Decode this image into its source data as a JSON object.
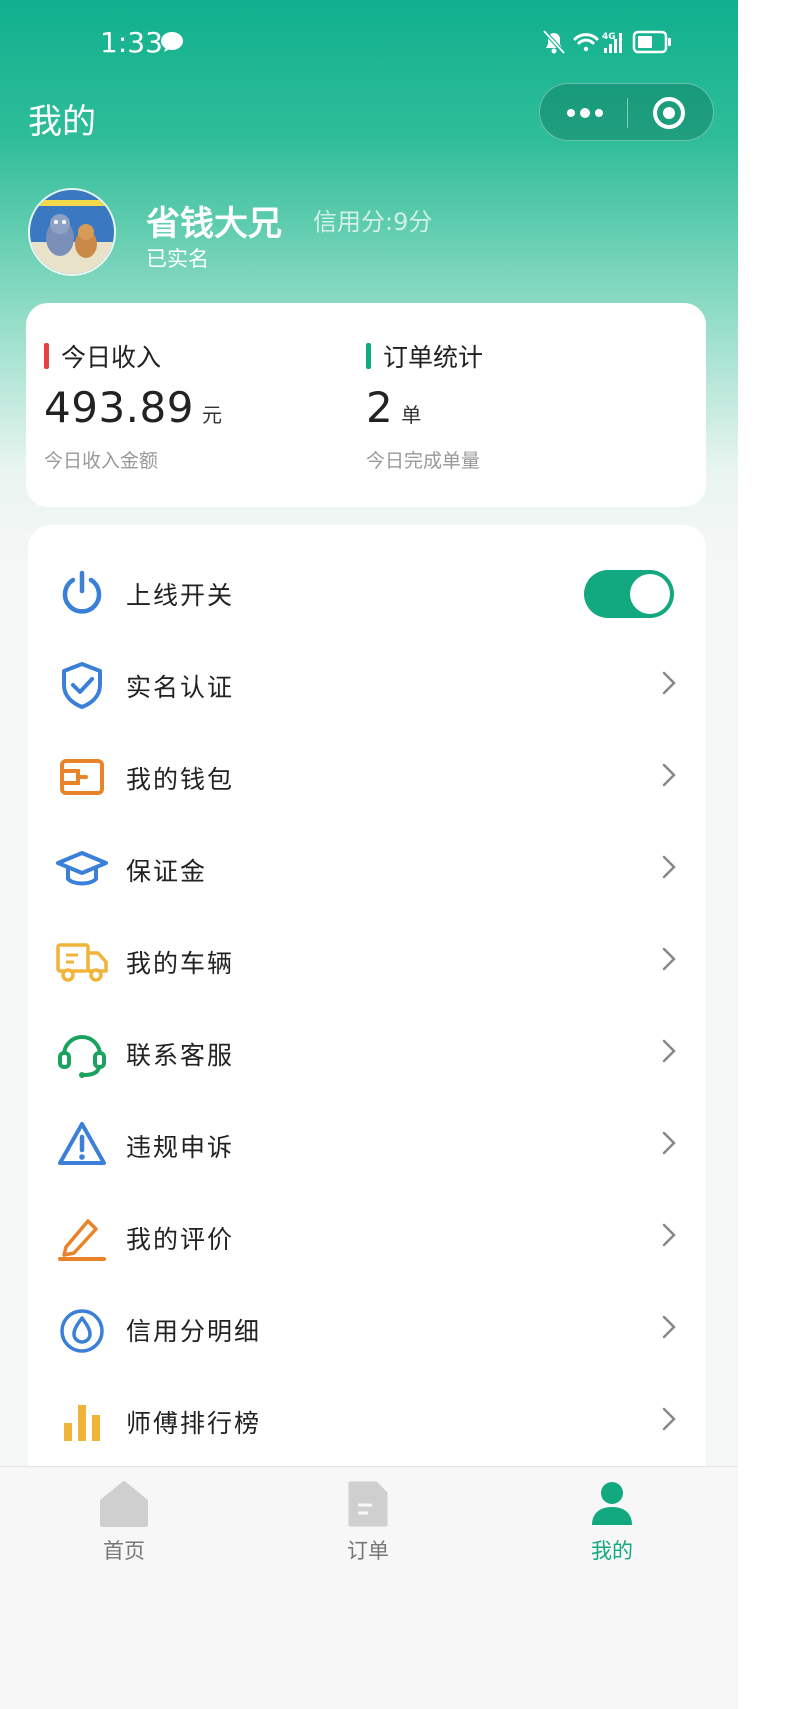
{
  "status_bar": {
    "time": "1:33",
    "network": "4G"
  },
  "header": {
    "title": "我的"
  },
  "capsule": {
    "more_icon": "more-dots-icon",
    "close_icon": "target-close-icon"
  },
  "profile": {
    "name": "省钱大兄",
    "credit_score": "信用分:9分",
    "verified": "已实名"
  },
  "stats": {
    "income": {
      "title": "今日收入",
      "value": "493.89",
      "unit": "元",
      "caption": "今日收入金额",
      "color": "#e8413a"
    },
    "orders": {
      "title": "订单统计",
      "value": "2",
      "unit": "单",
      "caption": "今日完成单量",
      "color": "#12a880"
    }
  },
  "menu": {
    "items": [
      {
        "label": "上线开关",
        "icon": "power-icon",
        "toggle_on": true
      },
      {
        "label": "实名认证",
        "icon": "shield-check-icon"
      },
      {
        "label": "我的钱包",
        "icon": "wallet-icon"
      },
      {
        "label": "保证金",
        "icon": "graduation-cap-icon"
      },
      {
        "label": "我的车辆",
        "icon": "truck-icon"
      },
      {
        "label": "联系客服",
        "icon": "headset-icon"
      },
      {
        "label": "违规申诉",
        "icon": "warning-icon"
      },
      {
        "label": "我的评价",
        "icon": "pen-icon"
      },
      {
        "label": "信用分明细",
        "icon": "water-drop-icon"
      },
      {
        "label": "师傅排行榜",
        "icon": "bar-chart-icon"
      }
    ]
  },
  "tabbar": {
    "home": "首页",
    "orders": "订单",
    "mine": "我的",
    "active_color": "#12a880"
  }
}
